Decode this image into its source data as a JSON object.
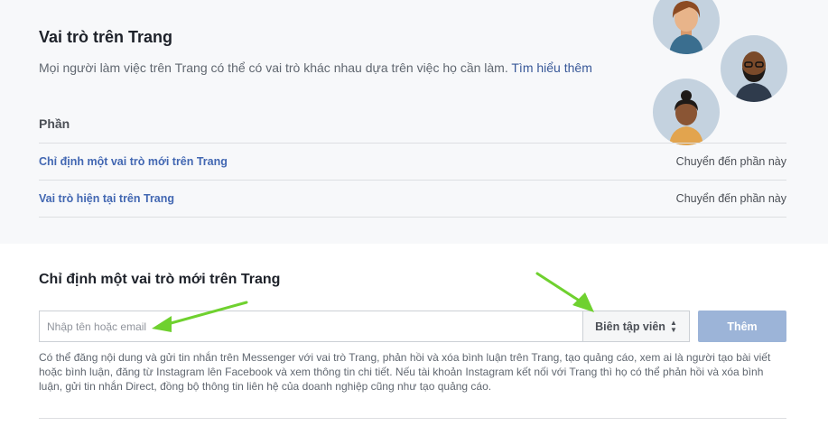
{
  "roles_header": {
    "title": "Vai trò trên Trang",
    "description": "Mọi người làm việc trên Trang có thể có vai trò khác nhau dựa trên việc họ cần làm.",
    "learn_more": "Tìm hiểu thêm"
  },
  "sections": {
    "heading": "Phần",
    "rows": [
      {
        "label": "Chỉ định một vai trò mới trên Trang",
        "link": "Chuyển đến phần này"
      },
      {
        "label": "Vai trò hiện tại trên Trang",
        "link": "Chuyển đến phần này"
      }
    ]
  },
  "assign": {
    "title": "Chỉ định một vai trò mới trên Trang",
    "input_placeholder": "Nhập tên hoặc email",
    "role_selected": "Biên tập viên",
    "add_label": "Thêm",
    "role_description": "Có thể đăng nội dung và gửi tin nhắn trên Messenger với vai trò Trang, phản hồi và xóa bình luận trên Trang, tạo quảng cáo, xem ai là người tạo bài viết hoặc bình luận, đăng từ Instagram lên Facebook và xem thông tin chi tiết. Nếu tài khoản Instagram kết nối với Trang thì họ có thể phản hồi và xóa bình luận, gửi tin nhắn Direct, đồng bộ thông tin liên hệ của doanh nghiệp cũng như tạo quảng cáo."
  },
  "colors": {
    "accent": "#4267b2",
    "add_button": "#9cb4d8",
    "annotation_arrow": "#6fd12f"
  }
}
